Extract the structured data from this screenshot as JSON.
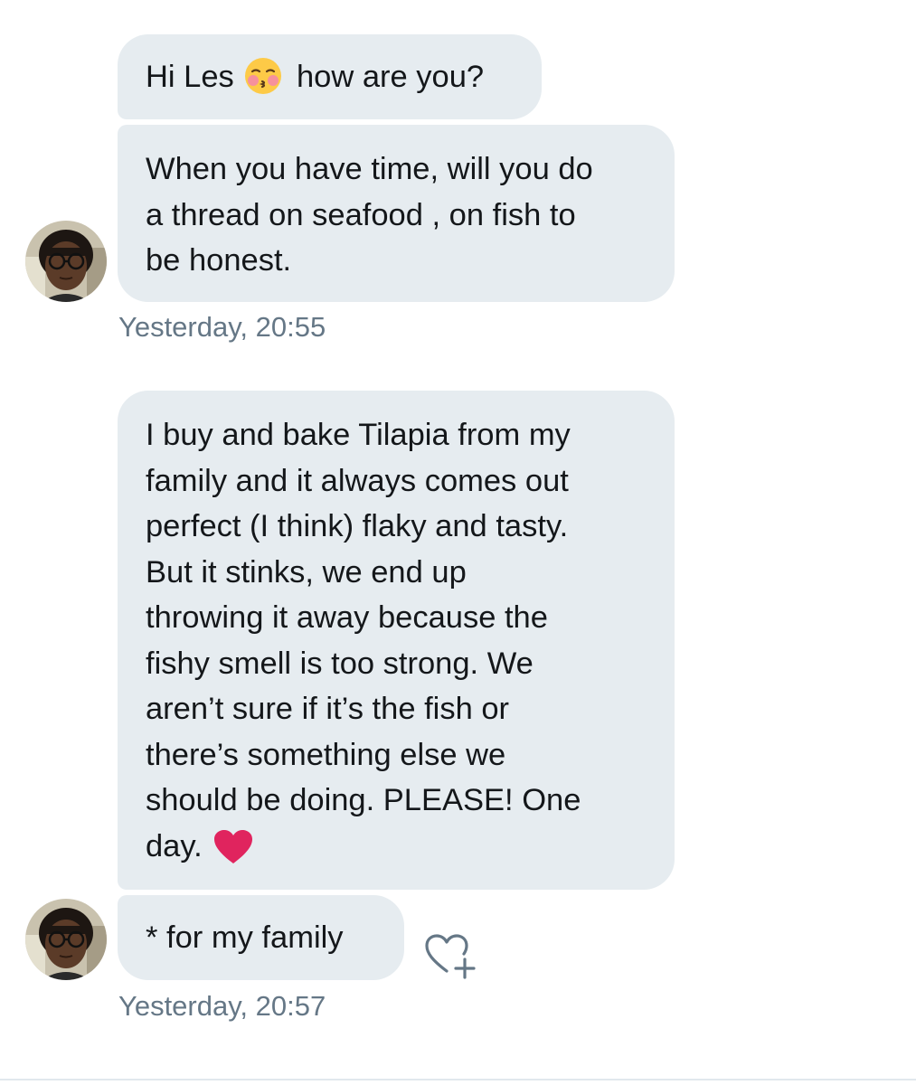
{
  "messages": [
    {
      "text_before": "Hi Les",
      "emoji": "kissing-face-emoji",
      "text_after": "how are you?"
    },
    {
      "lines": [
        "When you have time, will you do",
        "a thread on seafood , on fish to",
        "be honest."
      ]
    },
    {
      "lines": [
        "I buy and bake Tilapia from my",
        "family and it always comes out",
        "perfect (I think) flaky and tasty.",
        "But it stinks, we end up",
        "throwing it away because the",
        "fishy smell is too strong. We",
        "aren’t sure if it’s the fish or",
        "there’s something else we",
        "should be doing. PLEASE! One"
      ],
      "last_line": "day.",
      "emoji": "red-heart-emoji"
    },
    {
      "text": "* for my family"
    }
  ],
  "timestamps": [
    "Yesterday, 20:55",
    "Yesterday, 20:57"
  ],
  "icons": {
    "react": "heart-plus-icon",
    "avatar": "user-avatar"
  },
  "colors": {
    "bubble": "#e6ecf0",
    "text": "#14171a",
    "timestamp": "#657786",
    "heart": "#e0245e"
  }
}
